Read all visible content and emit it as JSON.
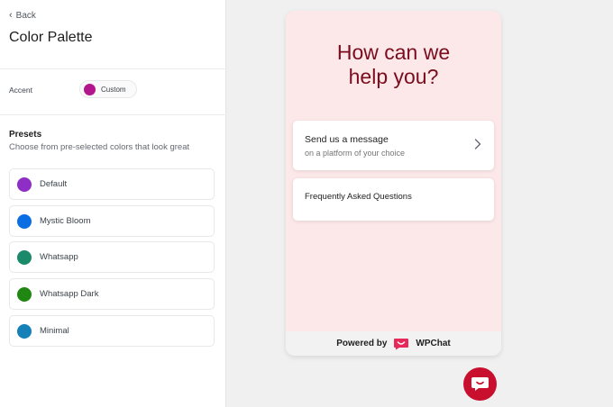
{
  "sidebar": {
    "back_label": "Back",
    "title": "Color Palette",
    "accent": {
      "label": "Accent",
      "value_label": "Custom",
      "color": "#b3168c"
    },
    "presets": {
      "title": "Presets",
      "subtitle": "Choose from pre-selected colors that look great",
      "items": [
        {
          "label": "Default",
          "color": "#8e2ec6"
        },
        {
          "label": "Mystic Bloom",
          "color": "#0b6fe3"
        },
        {
          "label": "Whatsapp",
          "color": "#1b8a6b"
        },
        {
          "label": "Whatsapp Dark",
          "color": "#1f8712"
        },
        {
          "label": "Minimal",
          "color": "#1680b8"
        }
      ]
    }
  },
  "preview": {
    "headline_line1": "How can we",
    "headline_line2": "help you?",
    "cards": [
      {
        "title": "Send us a message",
        "subtitle": "on a platform of your choice"
      },
      {
        "title": "Frequently Asked Questions"
      }
    ],
    "footer": {
      "powered_by": "Powered by",
      "brand": "WPChat"
    },
    "colors": {
      "background": "#fce8e8",
      "headline": "#7a0c1e",
      "brand": "#c8102e",
      "logo": "#e6285a"
    }
  }
}
